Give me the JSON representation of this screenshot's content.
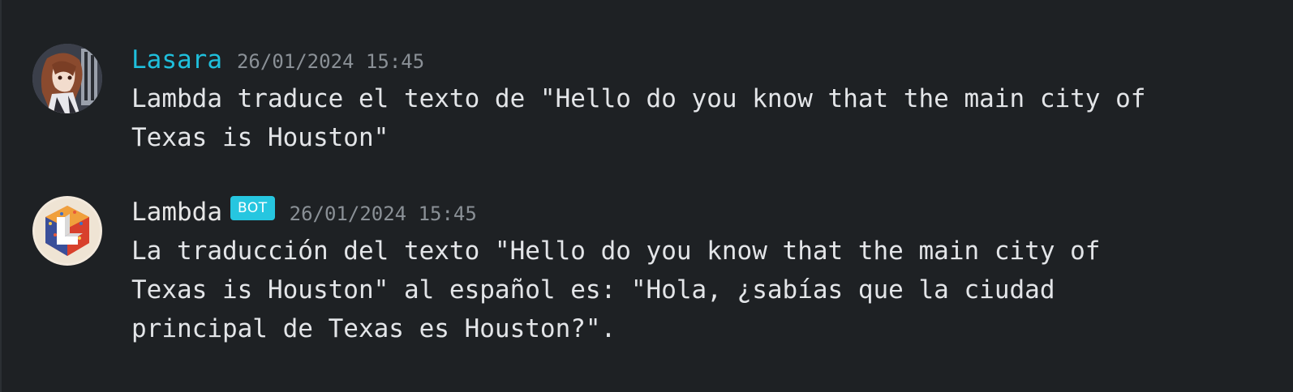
{
  "messages": [
    {
      "author": "Lasara",
      "is_bot": false,
      "timestamp": "26/01/2024 15:45",
      "text": "Lambda traduce el texto de \"Hello do you know that the main city of\nTexas is Houston\""
    },
    {
      "author": "Lambda",
      "is_bot": true,
      "badge": "BOT",
      "timestamp": "26/01/2024 15:45",
      "text": "La traducción del texto \"Hello do you know that the main city of\nTexas is Houston\" al español es: \"Hola, ¿sabías que la ciudad\nprincipal de Texas es Houston?\"."
    }
  ],
  "colors": {
    "background": "#1e2124",
    "user_name": "#1fbfdc",
    "bot_badge": "#26c6e0",
    "timestamp": "#8a9096",
    "text": "#e3e5e8"
  }
}
